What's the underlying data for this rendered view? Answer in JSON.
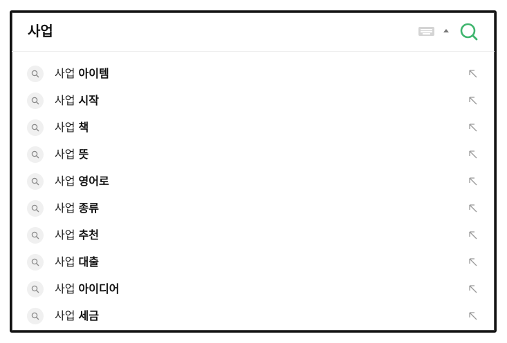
{
  "search": {
    "query": "사업",
    "keyboard_icon": "keyboard-icon",
    "toggle_icon": "caret-up-icon",
    "search_icon": "search-icon",
    "accent": "#2db400"
  },
  "suggestions": [
    {
      "prefix": "사업",
      "suffix": "아이템"
    },
    {
      "prefix": "사업",
      "suffix": "시작"
    },
    {
      "prefix": "사업",
      "suffix": "책"
    },
    {
      "prefix": "사업",
      "suffix": "뜻"
    },
    {
      "prefix": "사업",
      "suffix": "영어로"
    },
    {
      "prefix": "사업",
      "suffix": "종류"
    },
    {
      "prefix": "사업",
      "suffix": "추천"
    },
    {
      "prefix": "사업",
      "suffix": "대출"
    },
    {
      "prefix": "사업",
      "suffix": "아이디어"
    },
    {
      "prefix": "사업",
      "suffix": "세금"
    }
  ]
}
